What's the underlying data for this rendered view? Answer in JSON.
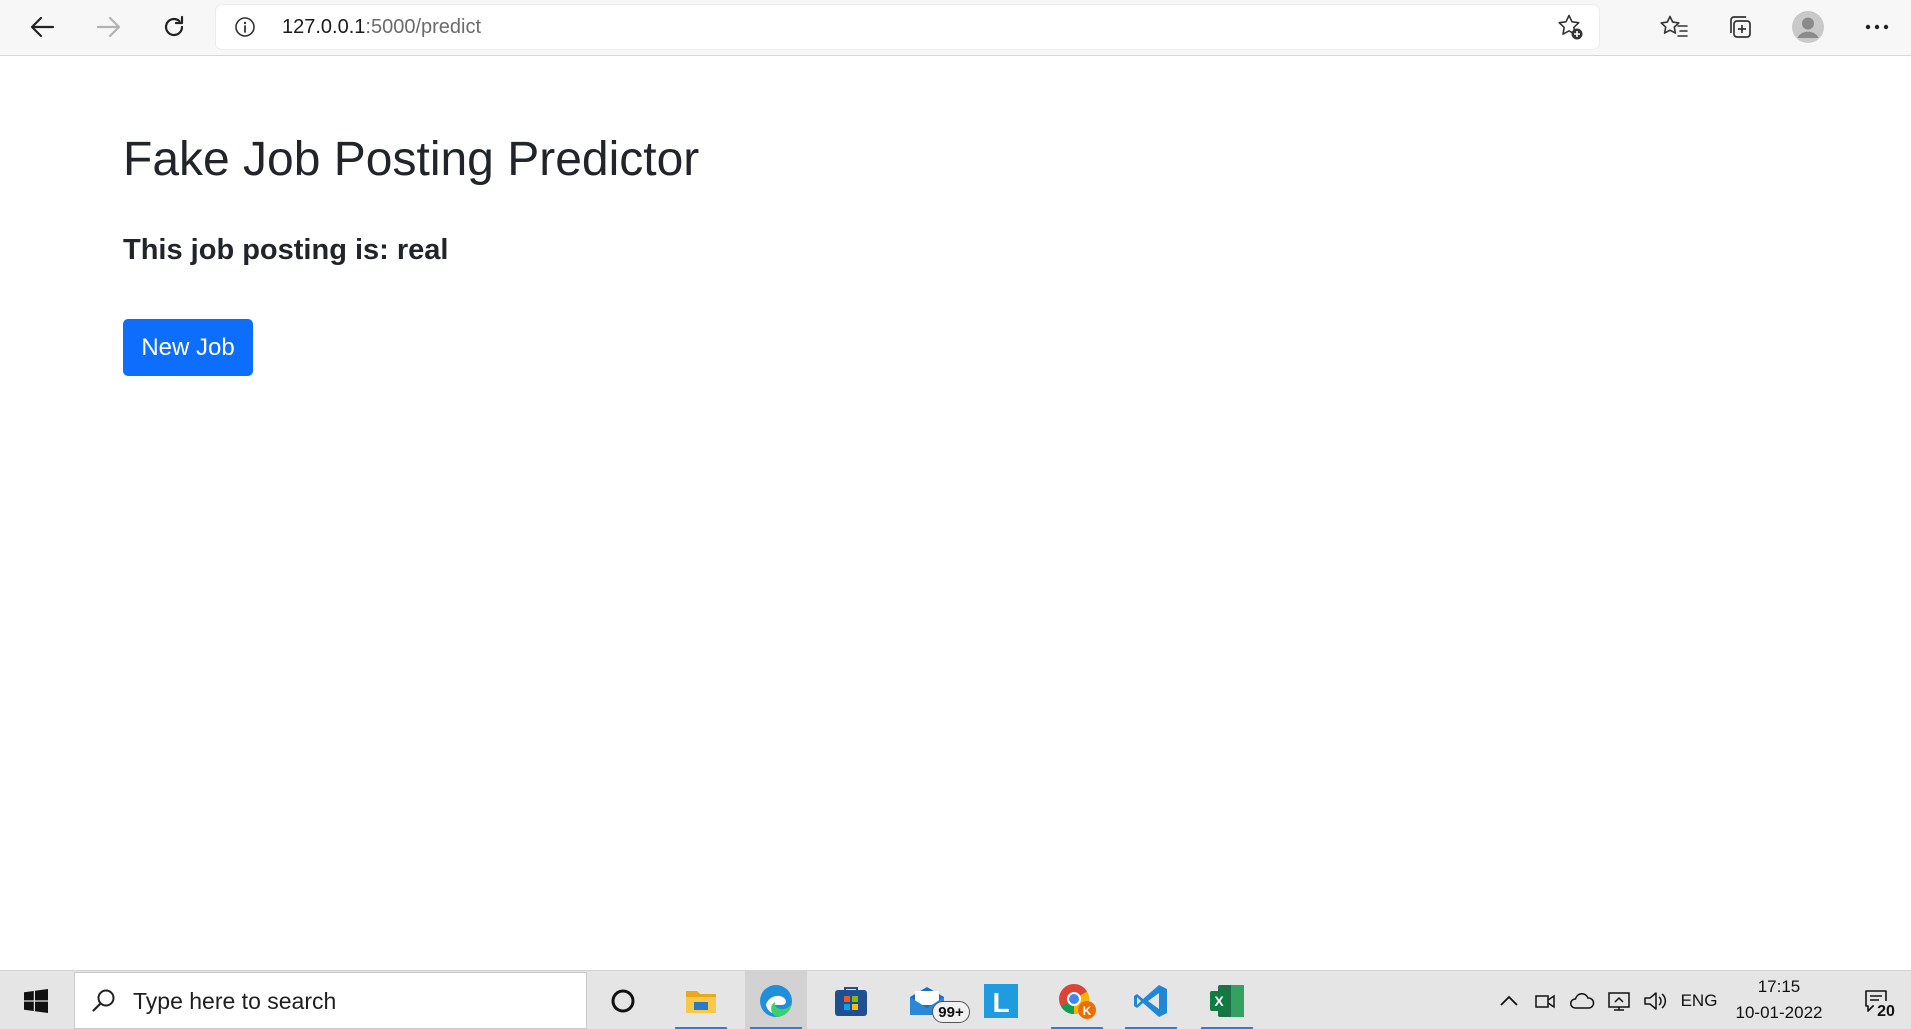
{
  "browser": {
    "address": {
      "host": "127.0.0.1",
      "path": ":5000/predict"
    },
    "icons": [
      "back-arrow-icon",
      "forward-arrow-icon",
      "refresh-icon",
      "info-icon",
      "add-favorite-icon",
      "favorites-icon",
      "collections-icon",
      "profile-icon",
      "more-icon"
    ]
  },
  "page": {
    "title": "Fake Job Posting Predictor",
    "result": "This job posting is: real",
    "new_job_label": "New Job",
    "accent_color": "#0d6efd"
  },
  "taskbar": {
    "search_placeholder": "Type here to search",
    "apps": [
      "start-icon",
      "cortana-icon",
      "file-explorer-icon",
      "edge-icon",
      "microsoft-store-icon",
      "mail-icon",
      "l-app-icon",
      "chrome-icon",
      "vscode-icon",
      "excel-icon"
    ],
    "mail_badge": "99+",
    "chrome_profile_letter": "K",
    "l_app_letter": "L",
    "excel_letter": "X",
    "language": "ENG",
    "time": "17:15",
    "date": "10-01-2022",
    "notification_count": "20"
  }
}
